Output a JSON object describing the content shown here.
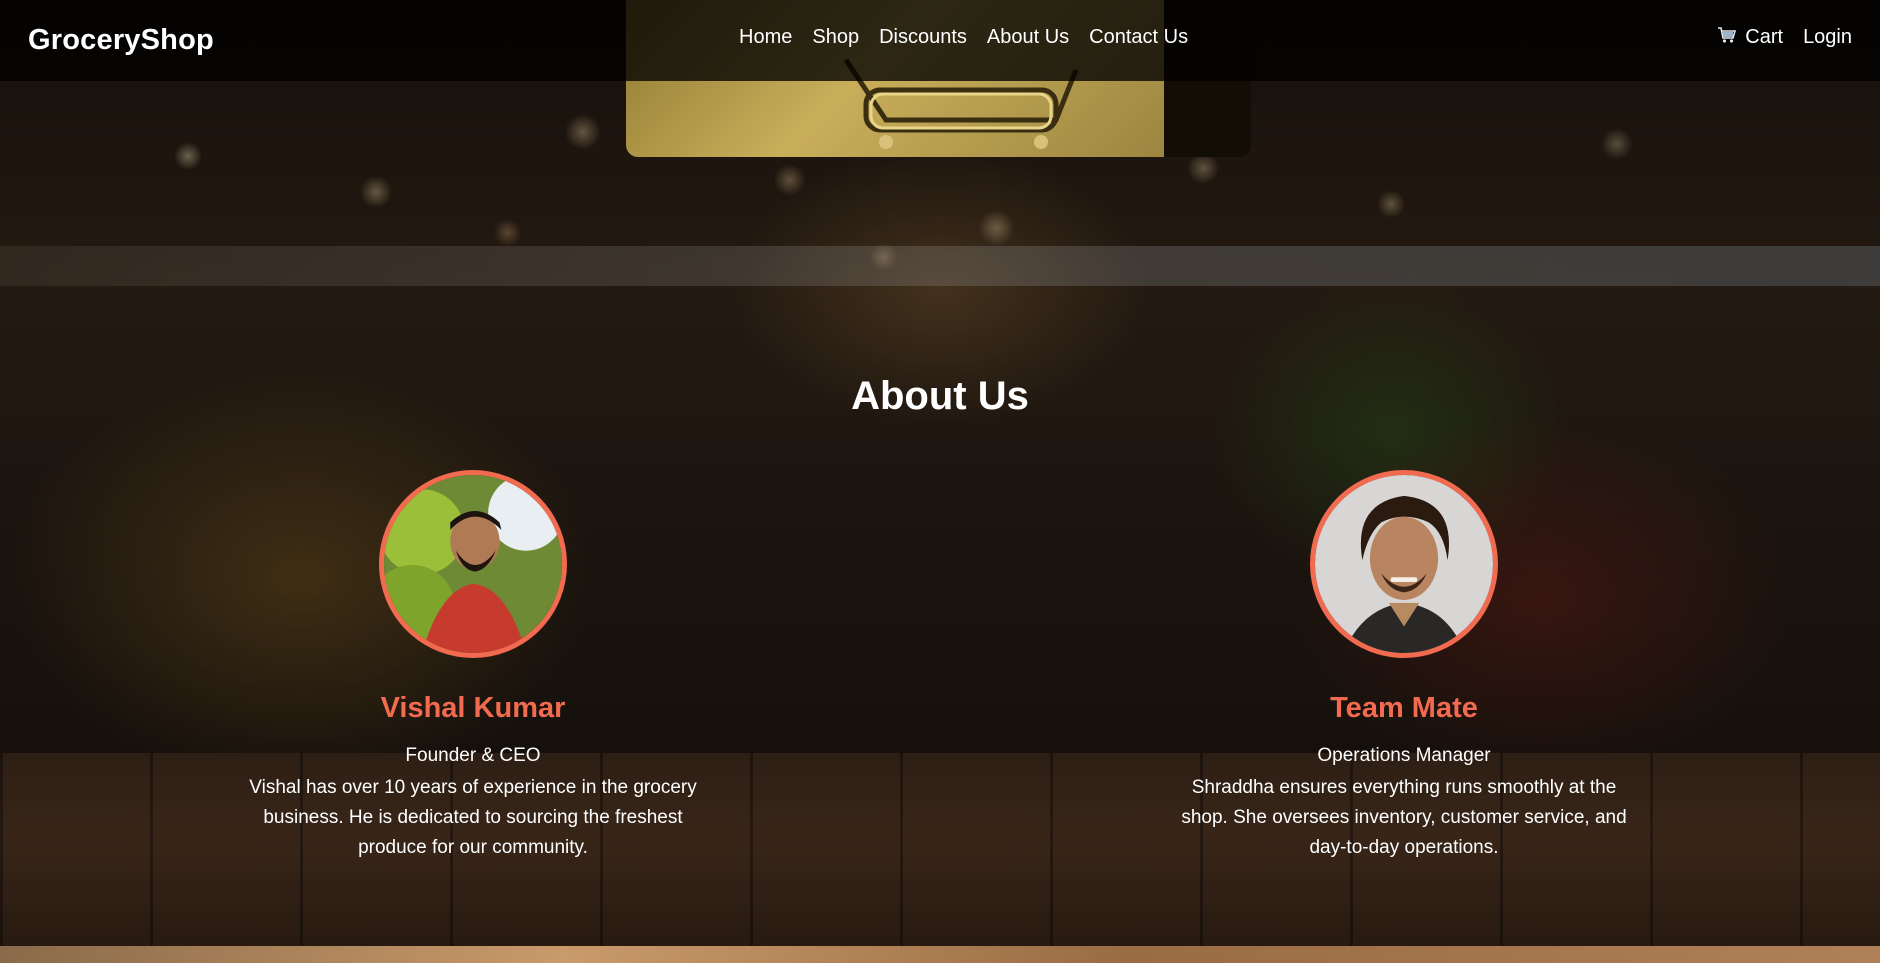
{
  "header": {
    "brand": "GroceryShop",
    "nav": [
      "Home",
      "Shop",
      "Discounts",
      "About Us",
      "Contact Us"
    ],
    "cart_label": "Cart",
    "login_label": "Login"
  },
  "about": {
    "title": "About Us",
    "members": [
      {
        "name": "Vishal Kumar",
        "role": "Founder & CEO",
        "bio": "Vishal has over 10 years of experience in the grocery business. He is dedicated to sourcing the freshest produce for our community."
      },
      {
        "name": "Team Mate",
        "role": "Operations Manager",
        "bio": "Shraddha ensures everything runs smoothly at the shop. She oversees inventory, customer service, and day-to-day operations."
      }
    ]
  },
  "colors": {
    "accent": "#f26a4f",
    "header_bg": "rgba(0,0,0,0.78)"
  },
  "icons": {
    "cart": "shopping-cart-icon"
  }
}
